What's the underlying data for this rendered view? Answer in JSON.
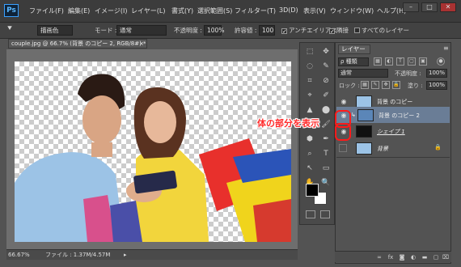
{
  "app": {
    "logo": "Ps"
  },
  "menu": [
    "ファイル(F)",
    "編集(E)",
    "イメージ(I)",
    "レイヤー(L)",
    "書式(Y)",
    "選択範囲(S)",
    "フィルター(T)",
    "3D(D)",
    "表示(V)",
    "ウィンドウ(W)",
    "ヘルプ(H)"
  ],
  "window_controls": {
    "minimize": "–",
    "maximize": "□",
    "close": "✕"
  },
  "options": {
    "tool_icon": "paint-bucket-icon",
    "fill_source": "描画色",
    "mode_label": "モード :",
    "mode_value": "通常",
    "opacity_label": "不透明度 :",
    "opacity_value": "100%",
    "tolerance_label": "許容値 :",
    "tolerance_value": "100",
    "antialias_label": "アンチエイリアス",
    "antialias_checked": "✓",
    "contiguous_label": "隣接",
    "contiguous_checked": "✓",
    "all_layers_label": "すべてのレイヤー"
  },
  "document": {
    "tab_title": "couple.jpg @ 66.7% (背景 のコピー 2, RGB/8#) *",
    "tab_close": "×",
    "status_zoom": "66.67%",
    "status_file": "ファイル : 1.37M/4.57M",
    "status_arrow": "▸"
  },
  "tools": [
    "⬚",
    "✥",
    "◌",
    "✎",
    "⌗",
    "⊘",
    "⌖",
    "✐",
    "▲",
    "⬤",
    "◆",
    "🖌",
    "⬢",
    "✒",
    "⌕",
    "T",
    "↖",
    "▭",
    "✋",
    "🔍"
  ],
  "layers_panel": {
    "tab_label": "レイヤー",
    "menu_icon": "≡",
    "kind_label": "ρ 種類",
    "blend_mode": "通常",
    "opacity_label": "不透明度 :",
    "opacity_value": "100%",
    "lock_label": "ロック :",
    "fill_label": "塗り :",
    "fill_value": "100%",
    "layers": [
      {
        "name": "背景 のコピー",
        "visible": true,
        "active": false
      },
      {
        "name": "背景 のコピー 2",
        "visible": true,
        "active": true
      },
      {
        "name": "シェイプ 1",
        "visible": true,
        "active": false
      },
      {
        "name": "背景",
        "visible": false,
        "active": false,
        "locked": true
      }
    ],
    "bottom_icons": [
      "link-icon",
      "fx-icon",
      "mask-icon",
      "adjustment-icon",
      "folder-icon",
      "new-layer-icon",
      "trash-icon"
    ]
  },
  "annotation": {
    "text": "体の部分を表示",
    "color": "#ff2a2a"
  },
  "colors": {
    "accent_selection": "#6a7d96",
    "annotation_red": "#ff1a1a"
  }
}
